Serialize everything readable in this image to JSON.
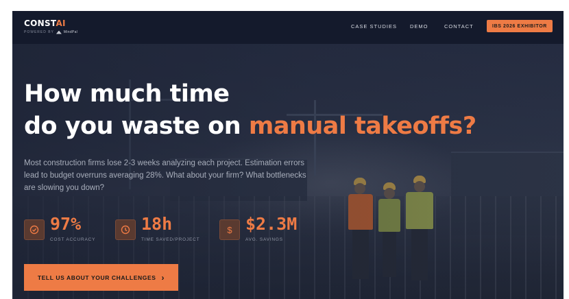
{
  "brand": {
    "name_main": "CONST",
    "name_accent": "AI",
    "powered_by": "POWERED BY",
    "partner": "MindPal"
  },
  "nav": {
    "links": [
      "CASE STUDIES",
      "DEMO",
      "CONTACT"
    ],
    "cta": "IBS 2026 EXHIBITOR"
  },
  "hero": {
    "headline_line1": "How much time",
    "headline_line2_prefix": "do you waste on ",
    "headline_accent": "manual takeoffs?",
    "description": "Most construction firms lose 2-3 weeks analyzing each project. Estimation errors lead to budget overruns averaging 28%. What about your firm? What bottlenecks are slowing you down?",
    "stats": [
      {
        "icon": "check-circle-icon",
        "value": "97%",
        "label": "COST ACCURACY"
      },
      {
        "icon": "clock-icon",
        "value": "18h",
        "label": "TIME SAVED/PROJECT"
      },
      {
        "icon": "dollar-icon",
        "value": "$2.3M",
        "label": "AVG. SAVINGS"
      }
    ],
    "cta": "TELL US ABOUT YOUR CHALLENGES",
    "cta_icon": "chevron-right-icon"
  },
  "colors": {
    "accent": "#ee7b45",
    "nav_bg": "#141a2c",
    "hero_overlay": "#1d2439"
  }
}
